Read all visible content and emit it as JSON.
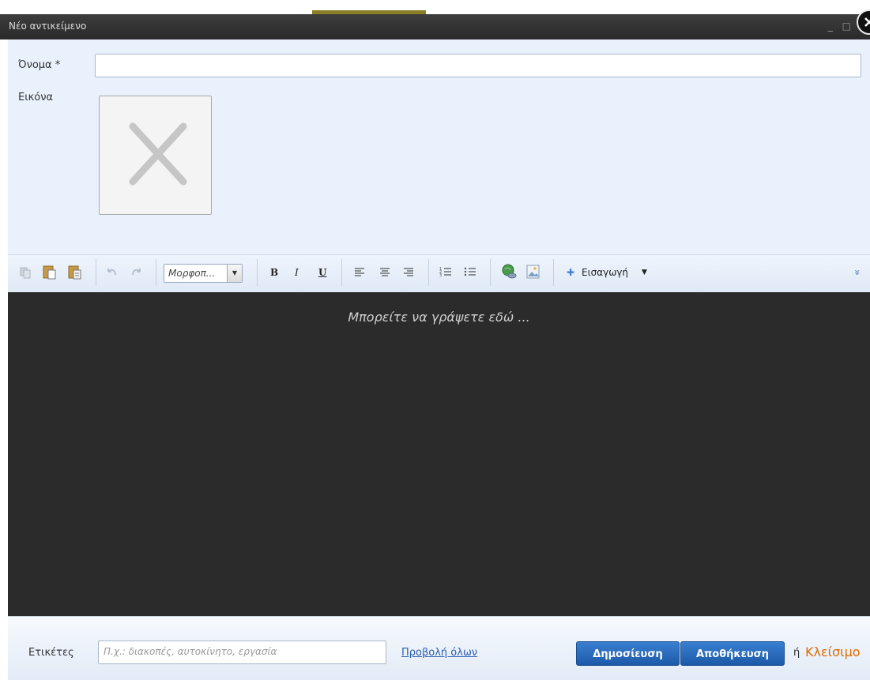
{
  "window": {
    "title": "Νέο αντικείμενο",
    "controls": "_ □"
  },
  "form": {
    "name_label": "Όνομα *",
    "image_label": "Εικόνα"
  },
  "toolbar": {
    "format_select": "Μορφοπ...",
    "bold": "B",
    "italic": "I",
    "underline": "U",
    "insert_label": "Εισαγωγή",
    "insert_plus": "✚",
    "expand": "»"
  },
  "editor": {
    "placeholder": "Μπορείτε να γράψετε εδώ ..."
  },
  "footer": {
    "tags_label": "Ετικέτες",
    "tags_placeholder": "Π.χ.: διακοπές, αυτοκίνητο, εργασία",
    "view_all": "Προβολή όλων",
    "publish": "Δημοσίευση",
    "save": "Αποθήκευση",
    "or": "ή",
    "close": "Κλείσιμο"
  }
}
